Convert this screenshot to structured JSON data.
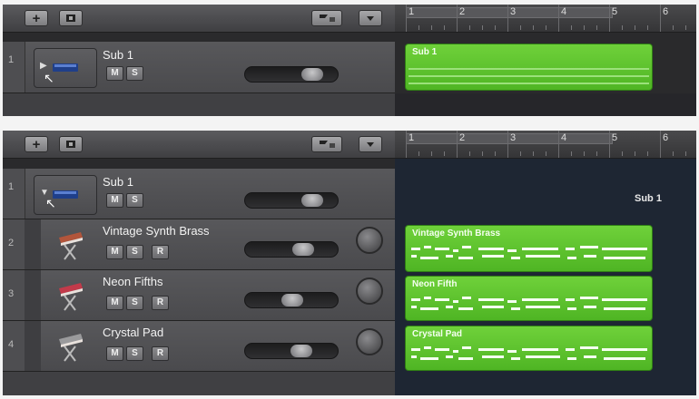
{
  "toolbar": {
    "add_label": "+",
    "add_icon": "add-track-icon",
    "folder_icon": "track-stack-icon",
    "flag_icon": "flag-menu-icon",
    "collapse_icon": "collapse-icon"
  },
  "ruler": {
    "bars": [
      "1",
      "2",
      "3",
      "4",
      "5",
      "6"
    ]
  },
  "collapsed": {
    "tracks": [
      {
        "num": "1",
        "name": "Sub 1",
        "m": "M",
        "s": "S",
        "volume": 0.72
      }
    ],
    "regions": [
      {
        "name": "Sub 1"
      }
    ]
  },
  "expanded": {
    "tracks": [
      {
        "num": "1",
        "name": "Sub 1",
        "m": "M",
        "s": "S",
        "volume": 0.72
      },
      {
        "num": "2",
        "name": "Vintage Synth Brass",
        "m": "M",
        "s": "S",
        "r": "R",
        "volume": 0.62
      },
      {
        "num": "3",
        "name": "Neon Fifths",
        "m": "M",
        "s": "S",
        "r": "R",
        "volume": 0.5
      },
      {
        "num": "4",
        "name": "Crystal Pad",
        "m": "M",
        "s": "S",
        "r": "R",
        "volume": 0.58
      }
    ],
    "stack_label": "Sub 1",
    "regions": [
      {
        "name": "Vintage Synth Brass"
      },
      {
        "name": "Neon Fifth"
      },
      {
        "name": "Crystal Pad"
      }
    ]
  },
  "colors": {
    "region_green": "#5cc12c",
    "lane_bg": "#1e2633"
  }
}
